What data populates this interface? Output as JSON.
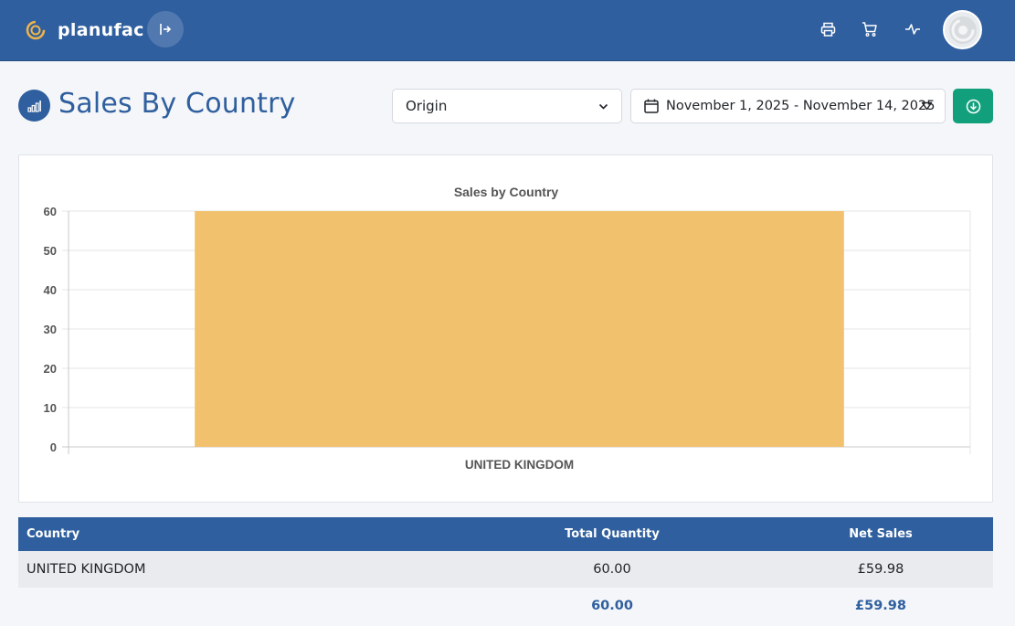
{
  "app": {
    "brand": "planufac"
  },
  "header": {
    "icons": [
      "print-icon",
      "cart-icon",
      "activity-icon"
    ],
    "accent": "#2f5f9e"
  },
  "page": {
    "title": "Sales By Country"
  },
  "filters": {
    "group_by": "Origin",
    "date_range": "November 1, 2025 - November 14, 2025",
    "download_color": "#12a07c"
  },
  "chart_data": {
    "type": "bar",
    "title": "Sales by Country",
    "categories": [
      "UNITED KINGDOM"
    ],
    "values": [
      60
    ],
    "ylim": [
      0,
      60
    ],
    "yticks": [
      0,
      10,
      20,
      30,
      40,
      50,
      60
    ],
    "grid": true,
    "bar_color": "#f2c16d"
  },
  "table": {
    "headers": [
      "Country",
      "Total Quantity",
      "Net Sales"
    ],
    "rows": [
      {
        "country": "UNITED KINGDOM",
        "quantity": "60.00",
        "net_sales": "£59.98"
      }
    ],
    "totals": {
      "quantity": "60.00",
      "net_sales": "£59.98"
    }
  }
}
